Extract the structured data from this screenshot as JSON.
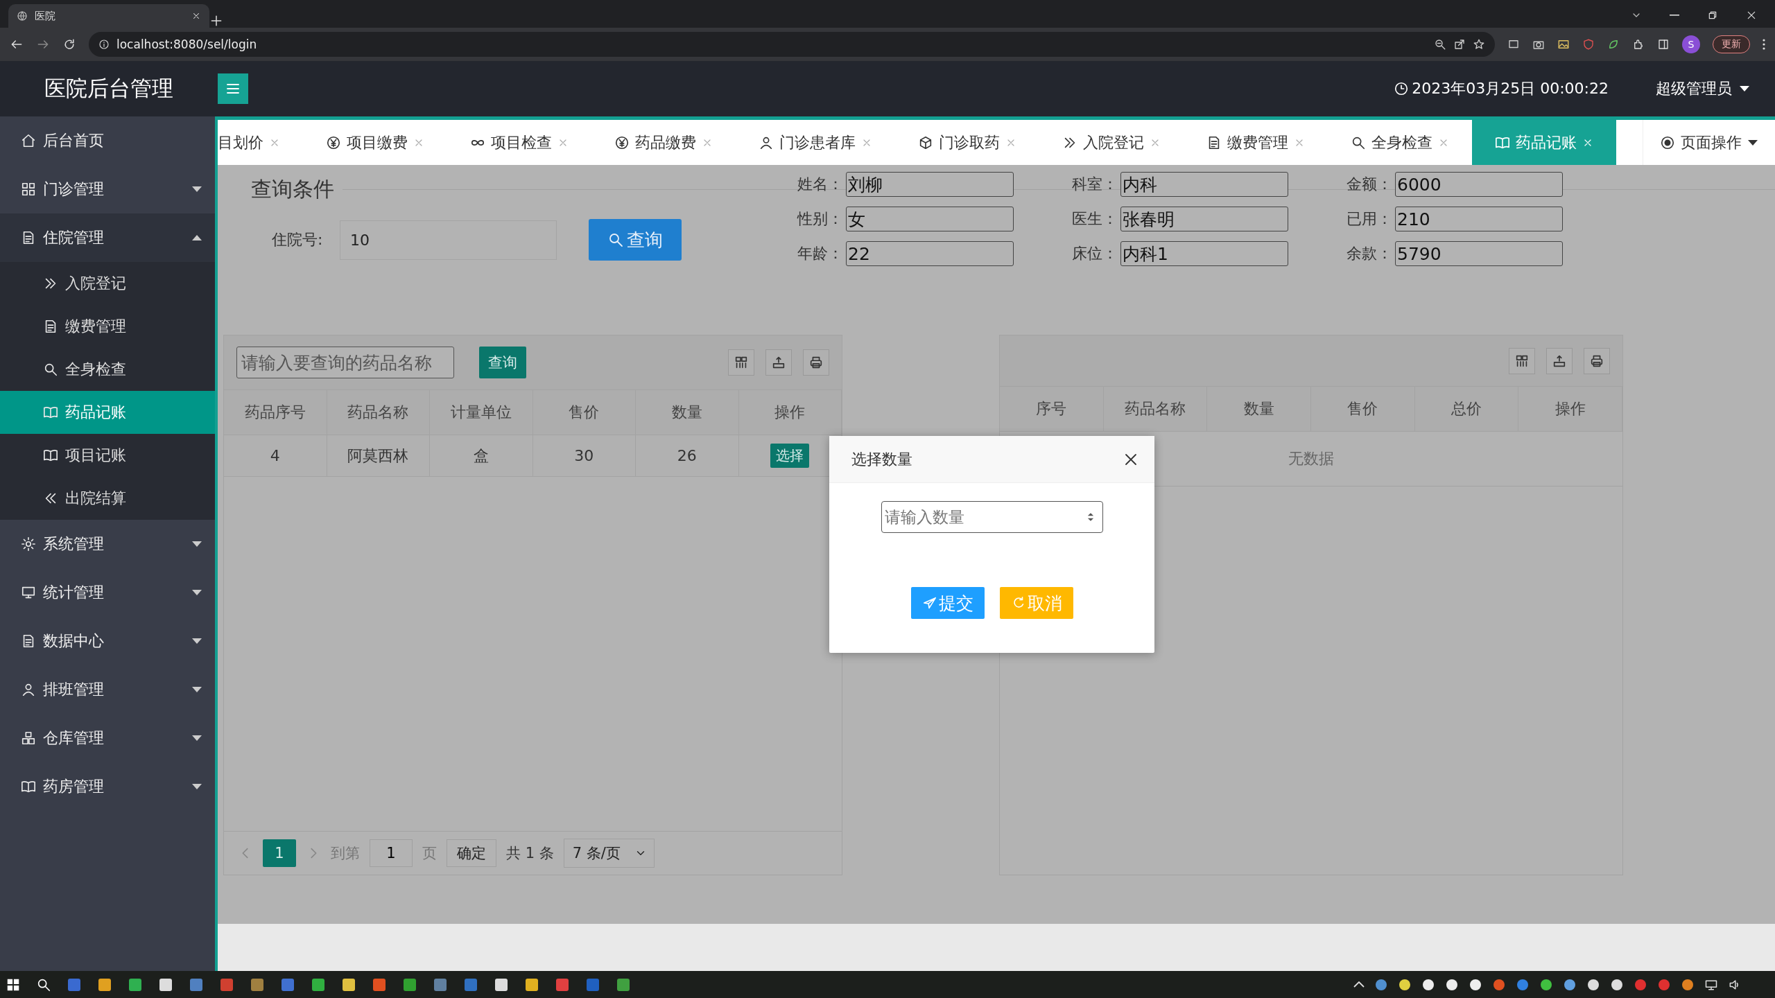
{
  "browser": {
    "tab_title": "医院",
    "url": "localhost:8080/sel/login",
    "profile_initial": "S",
    "update_button": "更新"
  },
  "header": {
    "title": "医院后台管理",
    "datetime": "2023年03月25日 00:00:22",
    "user": "超级管理员"
  },
  "sidebar": {
    "items": [
      {
        "label": "后台首页",
        "kind": "link"
      },
      {
        "label": "门诊管理",
        "kind": "group",
        "expanded": false
      },
      {
        "label": "住院管理",
        "kind": "group",
        "expanded": true,
        "children": [
          {
            "label": "入院登记",
            "selected": false
          },
          {
            "label": "缴费管理",
            "selected": false
          },
          {
            "label": "全身检查",
            "selected": false
          },
          {
            "label": "药品记账",
            "selected": true
          },
          {
            "label": "项目记账",
            "selected": false
          },
          {
            "label": "出院结算",
            "selected": false
          }
        ]
      },
      {
        "label": "系统管理",
        "kind": "group",
        "expanded": false
      },
      {
        "label": "统计管理",
        "kind": "group",
        "expanded": false
      },
      {
        "label": "数据中心",
        "kind": "group",
        "expanded": false
      },
      {
        "label": "排班管理",
        "kind": "group",
        "expanded": false
      },
      {
        "label": "仓库管理",
        "kind": "group",
        "expanded": false
      },
      {
        "label": "药房管理",
        "kind": "group",
        "expanded": false
      }
    ]
  },
  "tabs": [
    {
      "label": "目划价",
      "selected": false
    },
    {
      "label": "项目缴费",
      "selected": false
    },
    {
      "label": "项目检查",
      "selected": false
    },
    {
      "label": "药品缴费",
      "selected": false
    },
    {
      "label": "门诊患者库",
      "selected": false
    },
    {
      "label": "门诊取药",
      "selected": false
    },
    {
      "label": "入院登记",
      "selected": false
    },
    {
      "label": "缴费管理",
      "selected": false
    },
    {
      "label": "全身检查",
      "selected": false
    },
    {
      "label": "药品记账",
      "selected": true
    }
  ],
  "page_actions": "页面操作",
  "query": {
    "legend": "查询条件",
    "label": "住院号:",
    "value": "10",
    "button": "查询"
  },
  "patient_fields": [
    {
      "label": "姓名：",
      "value": "刘柳"
    },
    {
      "label": "科室：",
      "value": "内科"
    },
    {
      "label": "金额：",
      "value": "6000"
    },
    {
      "label": "性别：",
      "value": "女"
    },
    {
      "label": "医生：",
      "value": "张春明"
    },
    {
      "label": "已用：",
      "value": "210"
    },
    {
      "label": "年龄：",
      "value": "22"
    },
    {
      "label": "床位：",
      "value": "内科1"
    },
    {
      "label": "余款：",
      "value": "5790"
    }
  ],
  "drug_table": {
    "search_placeholder": "请输入要查询的药品名称",
    "search_button": "查询",
    "columns": [
      "药品序号",
      "药品名称",
      "计量单位",
      "售价",
      "数量",
      "操作"
    ],
    "rows": [
      {
        "cells": [
          "4",
          "阿莫西林",
          "盒",
          "30",
          "26"
        ],
        "action": "选择"
      }
    ],
    "pagination": {
      "pages": [
        {
          "label": "1",
          "selected": true
        }
      ],
      "goto_label": "到第",
      "goto_value": "1",
      "page_unit": "页",
      "confirm": "确定",
      "total": "共 1 条",
      "page_size": "7 条/页"
    }
  },
  "record_table": {
    "columns": [
      "序号",
      "药品名称",
      "数量",
      "售价",
      "总价",
      "操作"
    ],
    "empty_text": "无数据"
  },
  "dialog": {
    "title": "选择数量",
    "placeholder": "请输入数量",
    "submit": "提交",
    "cancel": "取消"
  }
}
